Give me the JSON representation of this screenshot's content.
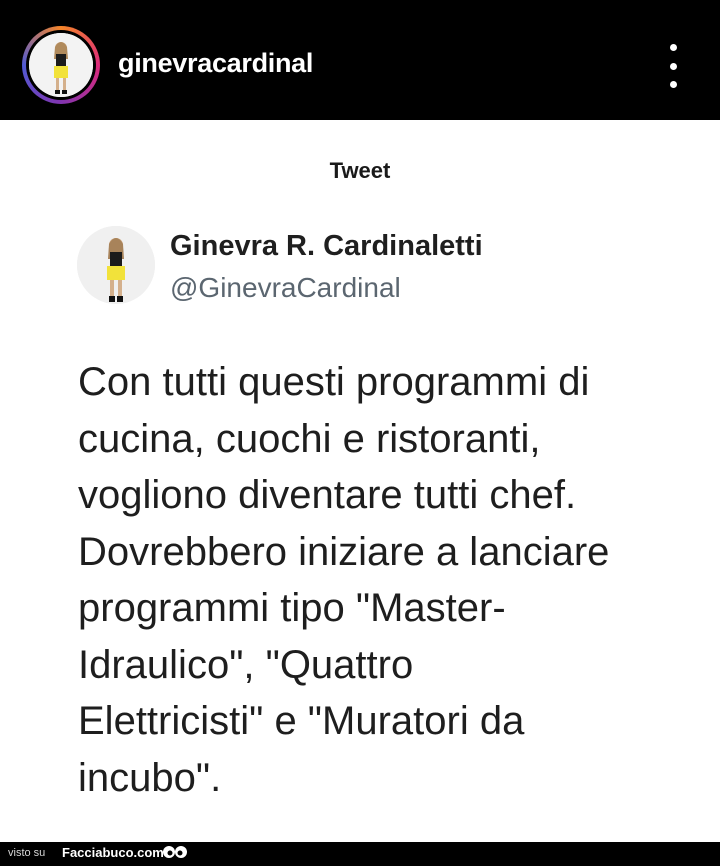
{
  "header": {
    "username": "ginevracardinal",
    "avatar_icon": "profile-photo",
    "more_icon": "vertical-ellipsis-icon",
    "story_ring_colors": [
      "#f58529",
      "#dd2a7b",
      "#8134af",
      "#515bd4"
    ]
  },
  "tweet": {
    "header_label": "Tweet",
    "display_name": "Ginevra R. Cardinaletti",
    "handle": "@GinevraCardinal",
    "text_lines": [
      "Con tutti questi programmi di",
      "cucina, cuochi e ristoranti,",
      "vogliono diventare tutti chef.",
      "Dovrebbero iniziare a lanciare",
      "programmi tipo \"Master-",
      "Idraulico\", \"Quattro",
      "Elettricisti\" e \"Muratori da",
      "incubo\"."
    ]
  },
  "footer": {
    "prefix": "visto su",
    "brand": "Facciabuco.com",
    "brand_icon": "eyes-icon"
  }
}
